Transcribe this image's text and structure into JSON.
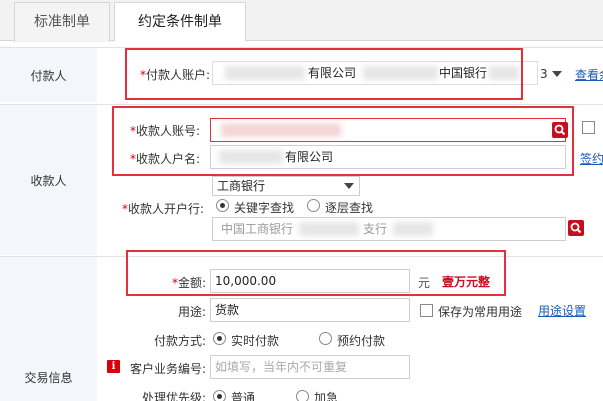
{
  "tabs": [
    {
      "label": "标准制单"
    },
    {
      "label": "约定条件制单"
    }
  ],
  "payer": {
    "section_label": "付款人",
    "account_label": "付款人账户:",
    "account_value_visible_1": "有限公司",
    "account_value_visible_2": "中国银行",
    "select_value": "3",
    "view_link": "查看余"
  },
  "payee": {
    "section_label": "收款人",
    "account_no_label": "收款人账号:",
    "account_no_value": "",
    "account_name_label": "收款人户名:",
    "account_name_value": "有限公司",
    "sign_link": "签约",
    "bank_select_value": "工商银行",
    "bank_label": "收款人开户行:",
    "search_mode": [
      {
        "label": "关键字查找",
        "selected": true
      },
      {
        "label": "逐层查找",
        "selected": false
      }
    ],
    "bank_input_part1": "中国工商银行",
    "bank_input_part2": "支行"
  },
  "transaction": {
    "section_label": "交易信息",
    "amount_label": "金额:",
    "amount_value": "10,000.00",
    "amount_unit": "元",
    "amount_in_words": "壹万元整",
    "usage_label": "用途:",
    "usage_value": "货款",
    "save_usage_label": "保存为常用用途",
    "usage_settings_link": "用途设置",
    "pay_mode_label": "付款方式:",
    "pay_modes": [
      {
        "label": "实时付款",
        "selected": true
      },
      {
        "label": "预约付款",
        "selected": false
      }
    ],
    "biz_no_label": "客户业务编号:",
    "biz_no_placeholder": "如填写，当年内不可重复",
    "priority_label": "处理优先级:",
    "priorities": [
      {
        "label": "普通",
        "selected": true
      },
      {
        "label": "加急",
        "selected": false
      }
    ]
  },
  "colors": {
    "highlight_box": "#e3303c",
    "amount_words": "#c50f1f",
    "link": "#1a5bb5",
    "section_bg": "#f3f6fa"
  }
}
